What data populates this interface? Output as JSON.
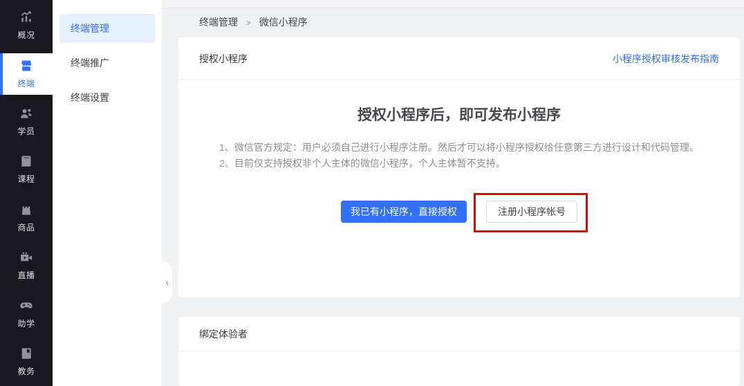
{
  "colors": {
    "accent_blue": "#3370ff",
    "rail_background": "#18181e",
    "active_pill_background": "#e8f0fe",
    "highlight_red": "#e60000"
  },
  "sidebar": {
    "items": [
      {
        "label": "概况",
        "icon": "trend-chart-icon",
        "active": false
      },
      {
        "label": "终端",
        "icon": "storefront-icon",
        "active": true
      },
      {
        "label": "学员",
        "icon": "users-icon",
        "active": false
      },
      {
        "label": "课程",
        "icon": "book-icon",
        "active": false
      },
      {
        "label": "商品",
        "icon": "shopping-bag-icon",
        "active": false
      },
      {
        "label": "直播",
        "icon": "video-camera-icon",
        "active": false
      },
      {
        "label": "助学",
        "icon": "game-controller-icon",
        "active": false
      },
      {
        "label": "教务",
        "icon": "notebook-icon",
        "active": false
      }
    ]
  },
  "submenu": {
    "items": [
      {
        "label": "终端管理",
        "active": true
      },
      {
        "label": "终端推广",
        "active": false
      },
      {
        "label": "终端设置",
        "active": false
      }
    ]
  },
  "collapse_handle": {
    "glyph": "‹"
  },
  "breadcrumb": {
    "items": [
      {
        "label": "终端管理"
      },
      {
        "label": "微信小程序"
      }
    ],
    "separator": ">"
  },
  "authorize_card": {
    "title": "授权小程序",
    "guide_link": "小程序授权审核发布指南",
    "heading": "授权小程序后，即可发布小程序",
    "notes": [
      "1、微信官方规定：用户必须自己进行小程序注册。然后才可以将小程序授权给任意第三方进行设计和代码管理。",
      "2、目前仅支持授权非个人主体的微信小程序，个人主体暂不支持。"
    ],
    "primary_button": "我已有小程序，直接授权",
    "secondary_button": "注册小程序帐号"
  },
  "tester_card": {
    "title": "绑定体验者"
  }
}
